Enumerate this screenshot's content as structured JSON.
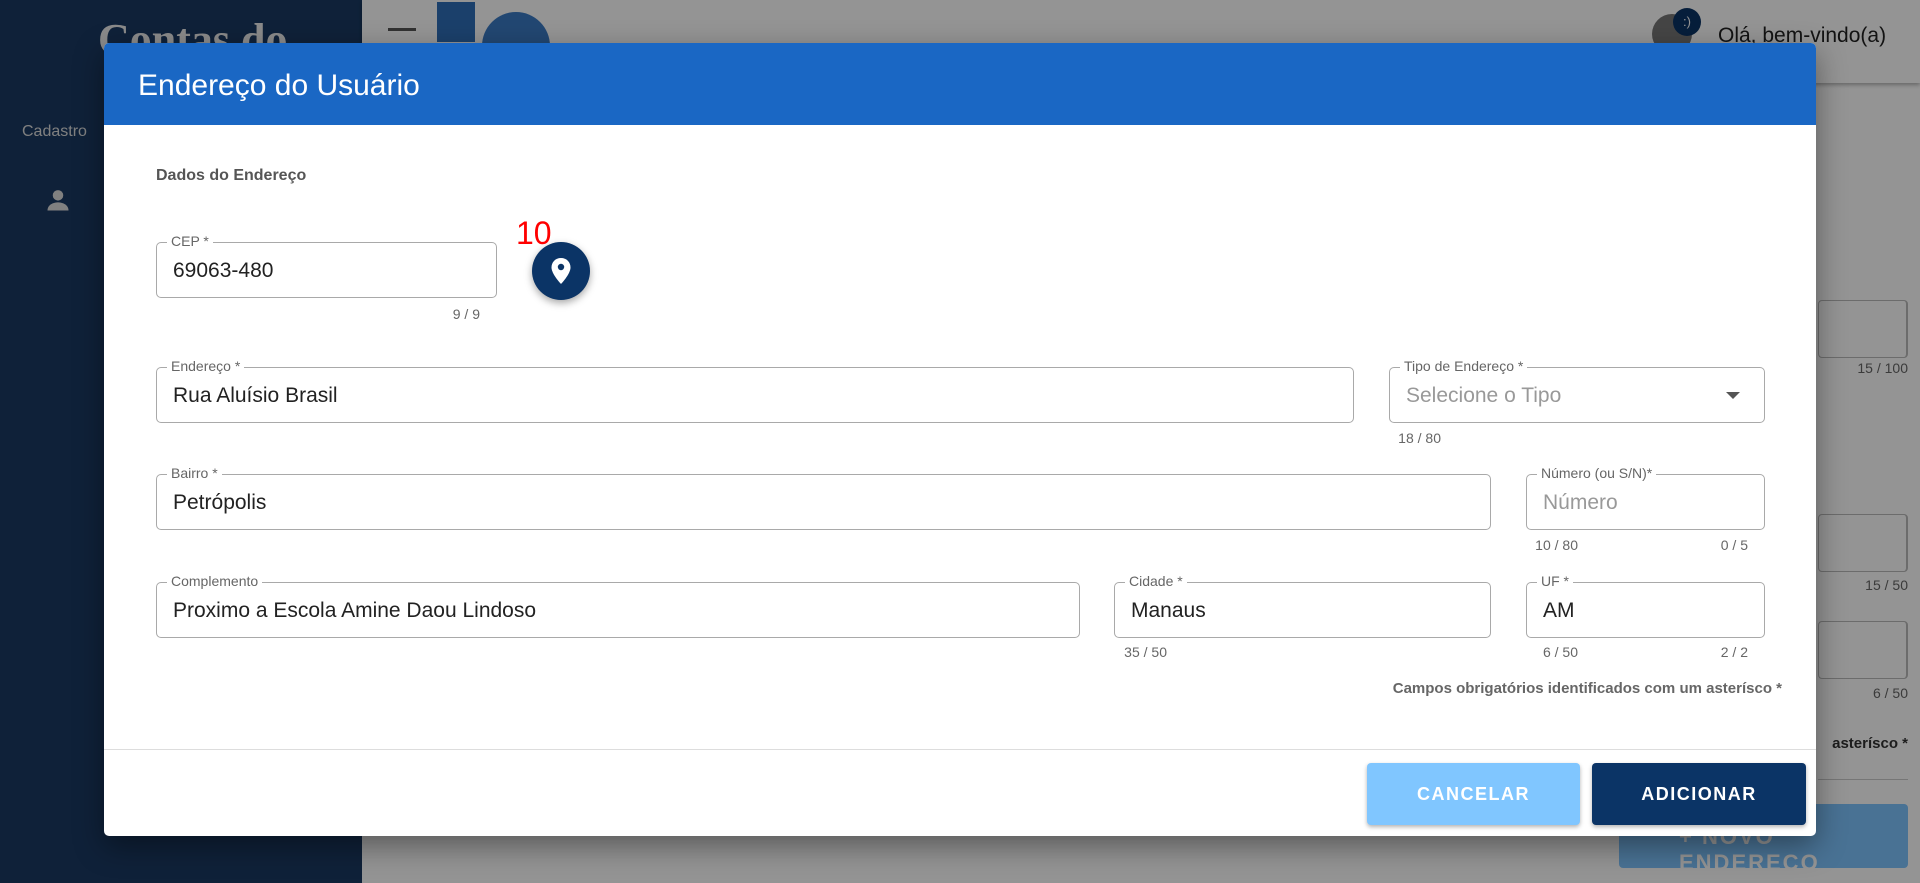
{
  "background": {
    "brand": "Contas do",
    "sidebar_item": "Cadastro",
    "greeting": "Olá, bem-vindo(a)",
    "badge": ":)",
    "counters": [
      "15 / 100",
      "15 / 50",
      "6 / 50"
    ],
    "note_fragment": "asterísco *",
    "new_address_button": "+ NOVO ENDEREÇO"
  },
  "modal": {
    "title": "Endereço do Usuário",
    "section": "Dados do Endereço",
    "annotation": "10",
    "fields": {
      "cep": {
        "label": "CEP *",
        "value": "69063-480",
        "counter": "9 / 9"
      },
      "endereco": {
        "label": "Endereço *",
        "value": "Rua Aluísio Brasil",
        "counter": "18 / 80"
      },
      "tipo": {
        "label": "Tipo de Endereço *",
        "placeholder": "Selecione o Tipo"
      },
      "bairro": {
        "label": "Bairro *",
        "value": "Petrópolis",
        "counter": "10 / 80"
      },
      "numero": {
        "label": "Número (ou S/N)*",
        "placeholder": "Número",
        "counter": "0 / 5"
      },
      "complemento": {
        "label": "Complemento",
        "value": "Proximo a Escola Amine Daou Lindoso",
        "counter": "35 / 50"
      },
      "cidade": {
        "label": "Cidade *",
        "value": "Manaus",
        "counter": "6 / 50"
      },
      "uf": {
        "label": "UF *",
        "value": "AM",
        "counter": "2 / 2"
      }
    },
    "required_note": "Campos obrigatórios identificados com um asterísco *",
    "cancel_label": "CANCELAR",
    "add_label": "ADICIONAR"
  },
  "colors": {
    "header": "#1a67c4",
    "primary": "#0b3466",
    "cancel": "#80c6ff"
  }
}
